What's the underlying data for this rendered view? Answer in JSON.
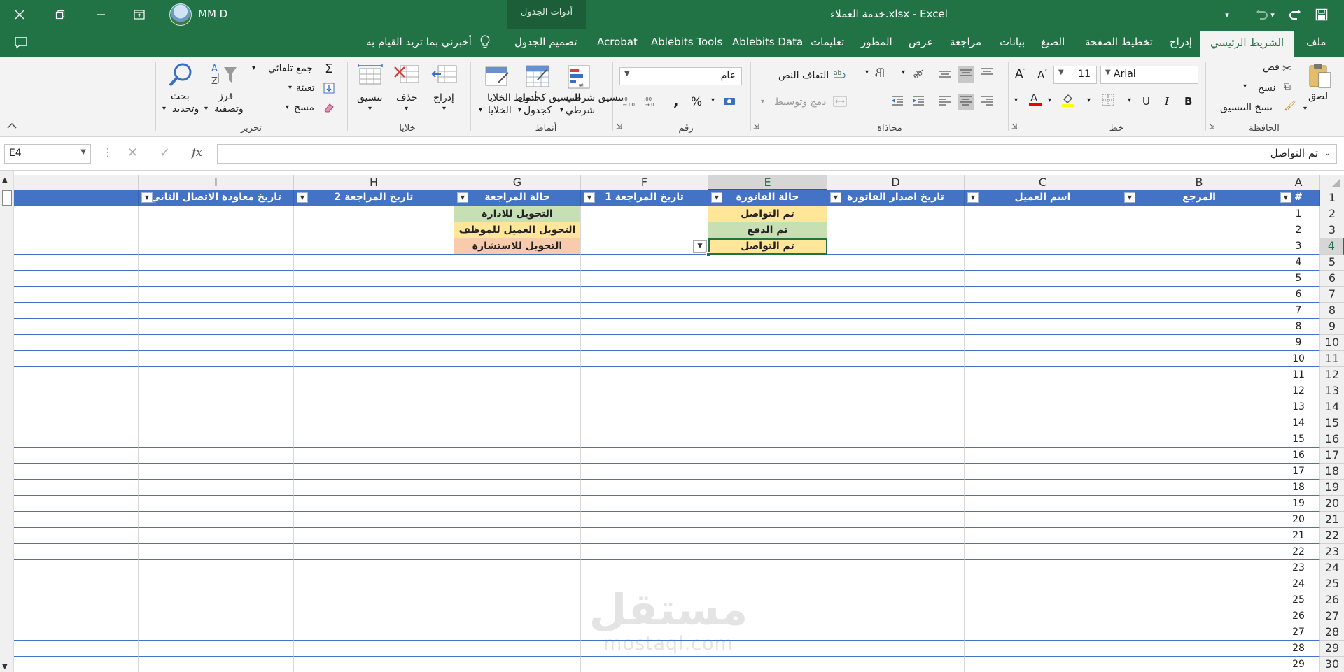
{
  "titlebar": {
    "doc_title": "خدمة العملاء.xlsx  -  Excel",
    "context_label": "أدوات الجدول",
    "user": "MM D",
    "icons": {
      "close": "close-icon",
      "restore": "restore-icon",
      "minimize": "minimize-icon",
      "ribbon_display": "ribbon-display-icon",
      "save": "save-icon",
      "undo": "undo-icon",
      "redo": "redo-icon"
    }
  },
  "tabs": {
    "file": "ملف",
    "home": "الشريط الرئيسي",
    "insert": "إدراج",
    "layout": "تخطيط الصفحة",
    "formulas": "الصيغ",
    "data": "بيانات",
    "review": "مراجعة",
    "view": "عرض",
    "developer": "المطور",
    "help": "تعليمات",
    "ablebits_data": "Ablebits Data",
    "ablebits_tools": "Ablebits Tools",
    "acrobat": "Acrobat",
    "table_design": "تصميم الجدول",
    "tell_me": "أخبرني بما تريد القيام به"
  },
  "ribbon": {
    "clipboard": {
      "label": "الحافظة",
      "paste": "لصق",
      "cut": "قص",
      "copy": "نسخ",
      "format_painter": "نسخ التنسيق"
    },
    "font": {
      "label": "خط",
      "font_name": "Arial",
      "font_size": "11",
      "bold": "B",
      "italic": "I",
      "underline": "U"
    },
    "alignment": {
      "label": "محاذاة",
      "wrap_text": "التفاف النص",
      "merge_center": "دمج وتوسيط"
    },
    "number": {
      "label": "رقم",
      "format": "عام",
      "percent": "%",
      "comma": ","
    },
    "styles": {
      "label": "أنماط",
      "conditional": "تنسيق شرطي",
      "format_table": "التنسيق كجدول",
      "cell_styles": "أنماط الخلايا"
    },
    "cells": {
      "label": "خلايا",
      "insert": "إدراج",
      "delete": "حذف",
      "format": "تنسيق"
    },
    "editing": {
      "label": "تحرير",
      "autosum": "جمع تلقائي",
      "fill": "تعبئة",
      "clear": "مسح",
      "sort_filter_1": "فرز",
      "sort_filter_2": "وتصفية",
      "find_select_1": "بحث",
      "find_select_2": "وتحديد"
    }
  },
  "formula_bar": {
    "name_box": "E4",
    "fx": "fx",
    "content": "تم التواصل"
  },
  "sheet": {
    "columns": [
      "A",
      "B",
      "C",
      "D",
      "E",
      "F",
      "G",
      "H",
      "I"
    ],
    "selected_column": "E",
    "selected_row": "4",
    "table_headers": {
      "A": "#",
      "B": "المرجع",
      "C": "اسم العميل",
      "D": "تاريخ اصدار الفاتورة",
      "E": "حالة الفاتورة",
      "F": "تاريخ المراجعة 1",
      "G": "حالة المراجعة",
      "H": "تاريخ المراجعة 2",
      "I": "تاريخ معاودة الاتصال الثاني"
    },
    "row_numbers": [
      "1",
      "2",
      "3",
      "4",
      "5",
      "6",
      "7",
      "8",
      "9",
      "10",
      "11",
      "12",
      "13",
      "14",
      "15",
      "16",
      "17",
      "18",
      "19",
      "20",
      "21",
      "22",
      "23",
      "24",
      "25",
      "26",
      "27",
      "28",
      "29",
      "30"
    ],
    "a_values": [
      "1",
      "2",
      "3",
      "4",
      "5",
      "6",
      "7",
      "8",
      "9",
      "10",
      "11",
      "12",
      "13",
      "14",
      "15",
      "16",
      "17",
      "18",
      "19",
      "20",
      "21",
      "22",
      "23",
      "24",
      "25",
      "26",
      "27",
      "28",
      "29"
    ],
    "invoice_status": [
      "تم التواصل",
      "تم الدفع",
      "تم التواصل"
    ],
    "review_status": [
      "التحويل للادارة",
      "التحويل العميل للموظف",
      "التحويل للاستشارة"
    ],
    "colors": {
      "header_blue": "#4472c4",
      "green": "#c6e0b4",
      "yellow": "#ffe699",
      "orange": "#f8cbad",
      "accent": "#217346"
    }
  },
  "watermark": {
    "arabic": "مستقل",
    "latin": "mostaql.com"
  }
}
